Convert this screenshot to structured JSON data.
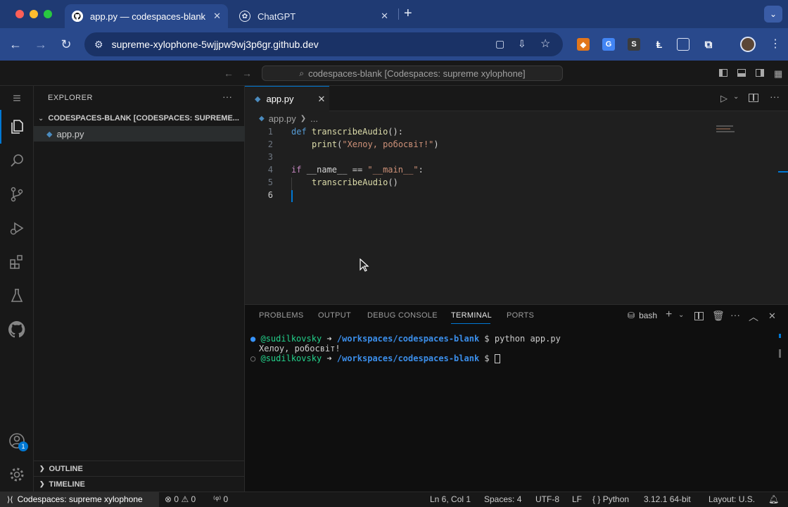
{
  "browser": {
    "tabs": [
      {
        "title": "app.py — codespaces-blank",
        "active": true,
        "icon": "github-icon"
      },
      {
        "title": "ChatGPT",
        "active": false,
        "icon": "chatgpt-icon"
      }
    ],
    "new_tab": "+",
    "url": "supreme-xylophone-5wjjpw9wj3p6gr.github.dev"
  },
  "vscode": {
    "command_center": "codespaces-blank [Codespaces: supreme xylophone]",
    "sidebar": {
      "title": "EXPLORER",
      "folder": "CODESPACES-BLANK [CODESPACES: SUPREME...",
      "files": [
        "app.py"
      ],
      "outline": "OUTLINE",
      "timeline": "TIMELINE"
    },
    "accounts_badge": "1",
    "editor": {
      "tab": "app.py",
      "breadcrumb_file": "app.py",
      "breadcrumb_more": "...",
      "line_numbers": [
        "1",
        "2",
        "3",
        "4",
        "5",
        "6"
      ],
      "lines": {
        "l1_def": "def",
        "l1_fn": "transcribeAudio",
        "l1_rest": "():",
        "l2_fn": "print",
        "l2_open": "(",
        "l2_str": "\"Хелоу, робосвіт!\"",
        "l2_close": ")",
        "l4_if": "if",
        "l4_name": "__name__",
        "l4_op": "==",
        "l4_str": "\"__main__\"",
        "l4_colon": ":",
        "l5_call": "transcribeAudio",
        "l5_paren": "()"
      }
    },
    "panel": {
      "tabs": [
        "PROBLEMS",
        "OUTPUT",
        "DEBUG CONSOLE",
        "TERMINAL",
        "PORTS"
      ],
      "active_tab": "TERMINAL",
      "shell": "bash",
      "terminal": {
        "user": "@sudilkovsky",
        "arrow": "➜",
        "path": "/workspaces/codespaces-blank",
        "prompt": "$",
        "command": "python app.py",
        "output": "Хелоу, робосвіт!"
      }
    },
    "status": {
      "remote": "Codespaces: supreme xylophone",
      "errors": "0",
      "warnings": "0",
      "ports": "0",
      "position": "Ln 6, Col 1",
      "spaces": "Spaces: 4",
      "encoding": "UTF-8",
      "eol": "LF",
      "braces": "{ }",
      "language": "Python",
      "interpreter": "3.12.1 64-bit",
      "layout": "Layout: U.S."
    },
    "colors": {
      "accent": "#0078d4",
      "browser_bar": "#29498c",
      "keyword": "#569cd6",
      "function": "#dcdcaa",
      "string": "#ce9178"
    }
  }
}
